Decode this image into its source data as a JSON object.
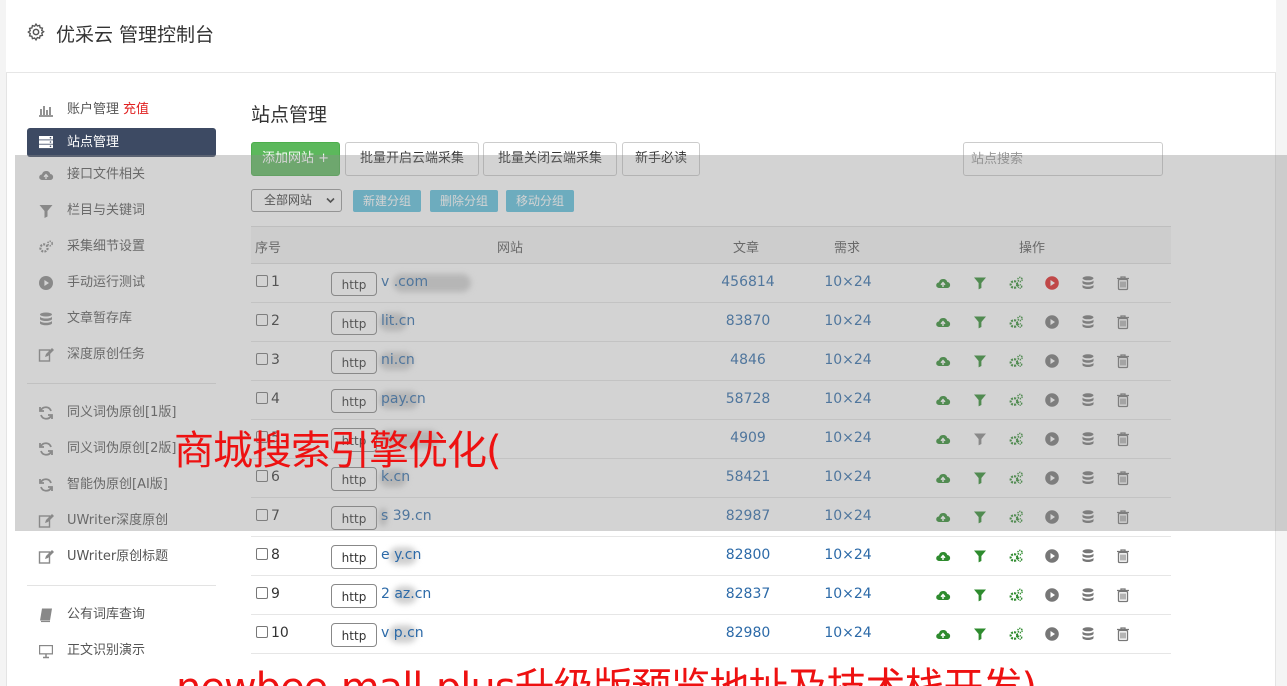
{
  "header": {
    "title": "优采云 管理控制台"
  },
  "sidebar": {
    "items": [
      {
        "label": "账户管理",
        "badge": "充值",
        "icon": "bar-chart-icon"
      },
      {
        "label": "站点管理",
        "icon": "server-icon",
        "active": true
      },
      {
        "label": "接口文件相关",
        "icon": "cloud-upload-icon"
      },
      {
        "label": "栏目与关键词",
        "icon": "filter-icon"
      },
      {
        "label": "采集细节设置",
        "icon": "gears-icon"
      },
      {
        "label": "手动运行测试",
        "icon": "play-circle-icon"
      },
      {
        "label": "文章暂存库",
        "icon": "database-icon"
      },
      {
        "label": "深度原创任务",
        "icon": "edit-icon"
      }
    ],
    "group2": [
      {
        "label": "同义词伪原创[1版]",
        "icon": "refresh-icon"
      },
      {
        "label": "同义词伪原创[2版]",
        "icon": "refresh-icon"
      },
      {
        "label": "智能伪原创[AI版]",
        "icon": "refresh-icon"
      },
      {
        "label": "UWriter深度原创",
        "icon": "edit-icon"
      },
      {
        "label": "UWriter原创标题",
        "icon": "edit-icon"
      }
    ],
    "group3": [
      {
        "label": "公有词库查询",
        "icon": "book-icon"
      },
      {
        "label": "正文识别演示",
        "icon": "monitor-icon"
      }
    ]
  },
  "main": {
    "title": "站点管理",
    "buttons": {
      "add_site": "添加网站 +",
      "enable_cloud": "批量开启云端采集",
      "disable_cloud": "批量关闭云端采集",
      "newbie": "新手必读"
    },
    "search_placeholder": "站点搜索",
    "group_select": "全部网站",
    "group_buttons": {
      "new": "新建分组",
      "delete": "删除分组",
      "move": "移动分组"
    },
    "columns": {
      "index": "序号",
      "site": "网站",
      "articles": "文章",
      "demand": "需求",
      "ops": "操作"
    },
    "rows": [
      {
        "num": "1",
        "proto": "http",
        "domain": "v            .com",
        "articles": "456814",
        "demand": "10×24",
        "running": true
      },
      {
        "num": "2",
        "proto": "http",
        "domain": "      lit.cn",
        "articles": "83870",
        "demand": "10×24",
        "running": false
      },
      {
        "num": "3",
        "proto": "http",
        "domain": "       ni.cn",
        "articles": "4846",
        "demand": "10×24",
        "running": false
      },
      {
        "num": "4",
        "proto": "http",
        "domain": "        pay.cn",
        "articles": "58728",
        "demand": "10×24",
        "running": false
      },
      {
        "num": "5",
        "proto": "http",
        "domain": "",
        "articles": "4909",
        "demand": "10×24",
        "running": false
      },
      {
        "num": "6",
        "proto": "http",
        "domain": "      k.cn",
        "articles": "58421",
        "demand": "10×24",
        "running": false
      },
      {
        "num": "7",
        "proto": "http",
        "domain": "s    39.cn",
        "articles": "82987",
        "demand": "10×24",
        "running": false
      },
      {
        "num": "8",
        "proto": "http",
        "domain": "e      y.cn",
        "articles": "82800",
        "demand": "10×24",
        "running": false
      },
      {
        "num": "9",
        "proto": "http",
        "domain": "2      az.cn",
        "articles": "82837",
        "demand": "10×24",
        "running": false
      },
      {
        "num": "10",
        "proto": "http",
        "domain": "v      p.cn",
        "articles": "82980",
        "demand": "10×24",
        "running": false
      }
    ]
  },
  "watermark": {
    "line1": "商城搜索引擎优化(",
    "line2": "newbee-mall-plus升级版预览地址及技术栈开发)"
  },
  "colors": {
    "accent_green": "#5cb85c",
    "info_blue": "#5bc0de",
    "sidebar_active": "#3d4a63",
    "link_blue": "#2c6aa8",
    "op_green": "#2e8b2e",
    "op_red": "#e02020",
    "watermark_red": "#ee1111"
  }
}
